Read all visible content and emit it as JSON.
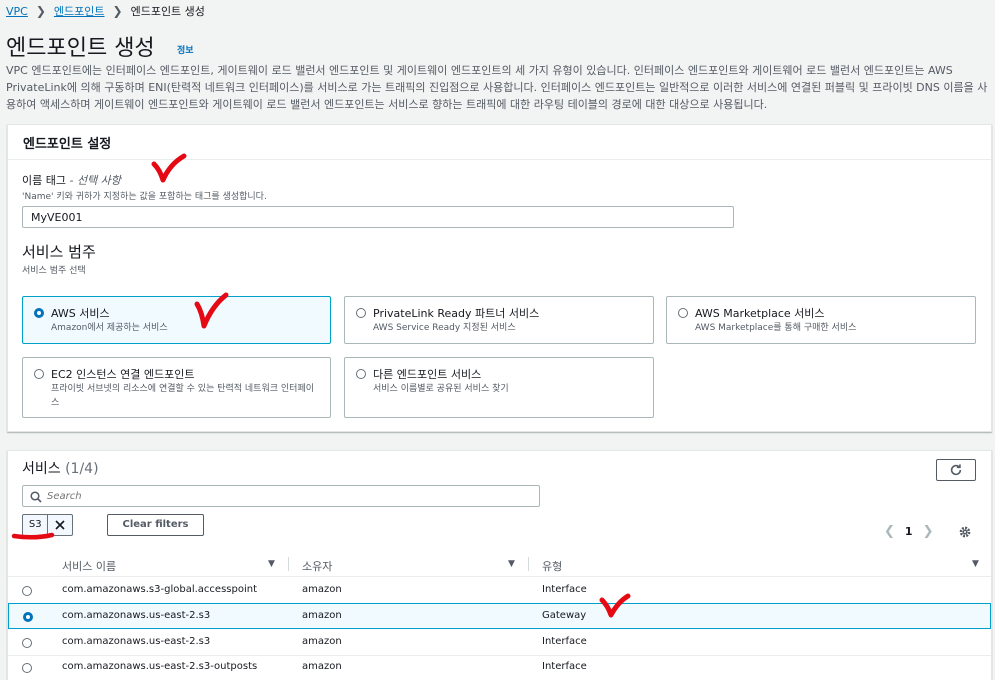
{
  "breadcrumb": {
    "vpc": "VPC",
    "endpoints": "엔드포인트",
    "current": "엔드포인트 생성"
  },
  "page": {
    "title": "엔드포인트 생성",
    "info": "정보",
    "description": "VPC 엔드포인트에는 인터페이스 엔드포인트, 게이트웨이 로드 밸런서 엔드포인트 및 게이트웨이 엔드포인트의 세 가지 유형이 있습니다. 인터페이스 엔드포인트와 게이트웨어 로드 밸런서 엔드포인트는 AWS PrivateLink에 의해 구동하며 ENI(탄력적 네트워크 인터페이스)를 서비스로 가는 트래픽의 진입점으로 사용합니다. 인터페이스 엔드포인트는 일반적으로 이러한 서비스에 연결된 퍼블릭 및 프라이빗 DNS 이름을 사용하여 액세스하며 게이트웨이 엔드포인트와 게이트웨이 로드 밸런서 엔드포인트는 서비스로 향하는 트래픽에 대한 라우팅 테이블의 경로에 대한 대상으로 사용됩니다."
  },
  "settings": {
    "header": "엔드포인트 설정",
    "name_label": "이름 태그",
    "name_optional": " - 선택 사항",
    "name_hint": "'Name' 키와 귀하가 지정하는 값을 포함하는 태그를 생성합니다.",
    "name_value": "MyVE001",
    "category_label": "서비스 범주",
    "category_hint": "서비스 범주 선택",
    "options": [
      {
        "title": "AWS 서비스",
        "desc": "Amazon에서 제공하는 서비스",
        "selected": true
      },
      {
        "title": "PrivateLink Ready 파트너 서비스",
        "desc": "AWS Service Ready 지정된 서비스",
        "selected": false
      },
      {
        "title": "AWS Marketplace 서비스",
        "desc": "AWS Marketplace를 통해 구매한 서비스",
        "selected": false
      },
      {
        "title": "EC2 인스턴스 연결 엔드포인트",
        "desc": "프라이빗 서브넷의 리소스에 연결할 수 있는 탄력적 네트워크 인터페이스",
        "selected": false
      },
      {
        "title": "다른 엔드포인트 서비스",
        "desc": "서비스 이름별로 공유된 서비스 찾기",
        "selected": false
      }
    ]
  },
  "services": {
    "title": "서비스",
    "count": "(1/4)",
    "search_placeholder": "Search",
    "filter_token": "S3",
    "clear_filters": "Clear filters",
    "page_number": "1",
    "columns": {
      "name": "서비스 이름",
      "owner": "소유자",
      "type": "유형"
    },
    "rows": [
      {
        "name": "com.amazonaws.s3-global.accesspoint",
        "owner": "amazon",
        "type": "Interface",
        "selected": false
      },
      {
        "name": "com.amazonaws.us-east-2.s3",
        "owner": "amazon",
        "type": "Gateway",
        "selected": true
      },
      {
        "name": "com.amazonaws.us-east-2.s3",
        "owner": "amazon",
        "type": "Interface",
        "selected": false
      },
      {
        "name": "com.amazonaws.us-east-2.s3-outposts",
        "owner": "amazon",
        "type": "Interface",
        "selected": false
      }
    ]
  },
  "colors": {
    "link": "#0073bb",
    "selected_border": "#00a1c9",
    "selected_bg": "#f1faff",
    "annotation": "#e50914"
  }
}
